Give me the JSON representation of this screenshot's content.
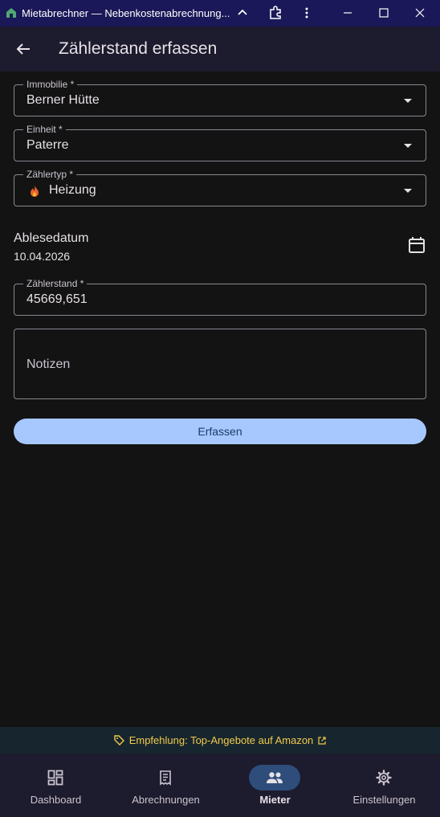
{
  "window": {
    "title": "Mietabrechner — Nebenkostenabrechnung..."
  },
  "appbar": {
    "title": "Zählerstand erfassen"
  },
  "form": {
    "property": {
      "label": "Immobilie *",
      "value": "Berner Hütte"
    },
    "unit": {
      "label": "Einheit *",
      "value": "Paterre"
    },
    "meter_type": {
      "label": "Zählertyp *",
      "value": "Heizung",
      "icon": "flame-icon"
    },
    "reading_date": {
      "label": "Ablesedatum",
      "value": "10.04.2026"
    },
    "meter_reading": {
      "label": "Zählerstand *",
      "value": "45669,651"
    },
    "notes": {
      "placeholder": "Notizen"
    },
    "submit_label": "Erfassen"
  },
  "promo": {
    "text": "Empfehlung: Top-Angebote auf Amazon"
  },
  "nav": {
    "items": [
      {
        "label": "Dashboard",
        "icon": "dashboard-icon"
      },
      {
        "label": "Abrechnungen",
        "icon": "receipt-icon"
      },
      {
        "label": "Mieter",
        "icon": "people-icon",
        "active": true
      },
      {
        "label": "Einstellungen",
        "icon": "gear-icon"
      }
    ]
  },
  "colors": {
    "titlebar": "#1a1858",
    "appbar": "#1d1b2e",
    "background": "#131313",
    "accent": "#a6c8ff",
    "promo_text": "#f2c94c",
    "flame": "#e8622c"
  }
}
